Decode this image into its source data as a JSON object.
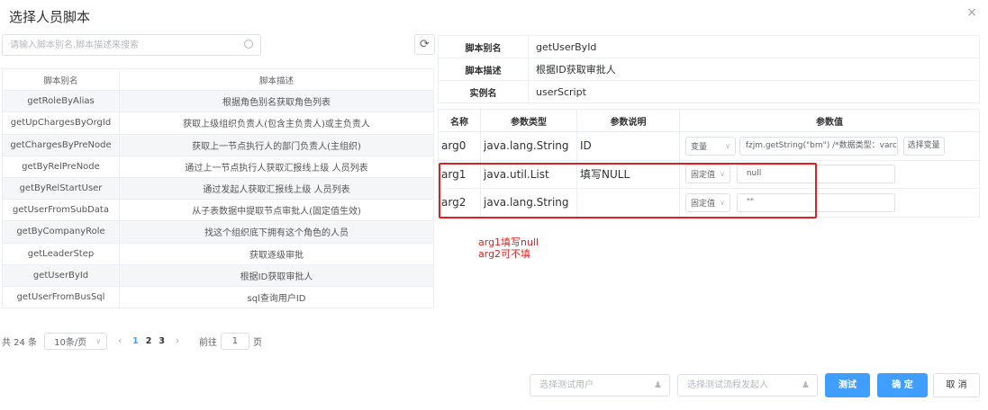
{
  "dialog": {
    "title": "选择人员脚本",
    "close": "×"
  },
  "search": {
    "placeholder": "请输入脚本别名,脚本描述来搜索"
  },
  "left_table": {
    "headers": [
      "脚本别名",
      "脚本描述"
    ],
    "rows": [
      [
        "getRoleByAlias",
        "根据角色别名获取角色列表"
      ],
      [
        "getUpChargesByOrgId",
        "获取上级组织负责人(包含主负责人)或主负责人"
      ],
      [
        "getChargesByPreNode",
        "获取上一节点执行人的部门负责人(主组织)"
      ],
      [
        "getByRelPreNode",
        "通过上一节点执行人获取汇报线上级 人员列表"
      ],
      [
        "getByRelStartUser",
        "通过发起人获取汇报线上级 人员列表"
      ],
      [
        "getUserFromSubData",
        "从子表数据中提取节点审批人(固定值生效)"
      ],
      [
        "getByCompanyRole",
        "找这个组织底下拥有这个角色的人员"
      ],
      [
        "getLeaderStep",
        "获取逐级审批"
      ],
      [
        "getUserById",
        "根据ID获取审批人"
      ],
      [
        "getUserFromBusSql",
        "sql查询用户ID"
      ]
    ]
  },
  "pagination": {
    "total": "共 24 条",
    "page_size": "10条/页",
    "prev": "‹",
    "pages": [
      "1",
      "2",
      "3"
    ],
    "next": "›",
    "goto": "前往",
    "page_input": "1",
    "page_unit": "页"
  },
  "info": {
    "rows": [
      {
        "key": "脚本别名",
        "value": "getUserById"
      },
      {
        "key": "脚本描述",
        "value": "根据ID获取审批人"
      },
      {
        "key": "实例名",
        "value": "userScript"
      }
    ]
  },
  "params": {
    "headers": [
      "名称",
      "参数类型",
      "参数说明",
      "参数值"
    ],
    "rows": [
      {
        "name": "arg0",
        "type": "java.lang.String",
        "desc": "ID",
        "mode": "变量",
        "value": "fzjm.getString(\"bm\") /*数据类型：varcha",
        "select_var": "选择变量"
      },
      {
        "name": "arg1",
        "type": "java.util.List",
        "desc": "填写NULL",
        "mode": "固定值",
        "value": "null"
      },
      {
        "name": "arg2",
        "type": "java.lang.String",
        "desc": "",
        "mode": "固定值",
        "value": "\"\""
      }
    ]
  },
  "note": {
    "line1": "arg1填写null",
    "line2": "arg2可不填"
  },
  "footer": {
    "test_user_placeholder": "选择测试用户",
    "test_starter_placeholder": "选择测试流程发起人",
    "test_button": "测试",
    "ok_button": "确 定",
    "cancel_button": "取 消"
  },
  "colors": {
    "primary": "#409eff",
    "annotation": "#e02020"
  }
}
